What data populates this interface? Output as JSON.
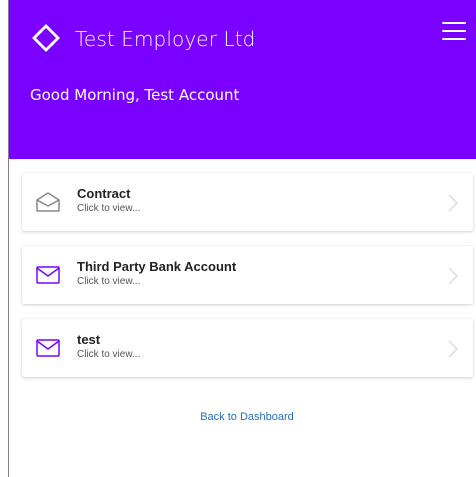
{
  "header": {
    "title": "Test Employer Ltd",
    "greeting": "Good Morning, Test Account",
    "background_color": "#7a00ff",
    "logo_icon": "logo-icon",
    "menu_icon": "hamburger-menu-icon"
  },
  "documents": [
    {
      "title": "Contract",
      "subtitle": "Click to view...",
      "icon": "envelope-open-icon",
      "icon_color": "#888888"
    },
    {
      "title": "Third Party Bank Account",
      "subtitle": "Click to view...",
      "icon": "envelope-icon",
      "icon_color": "#7a00ff"
    },
    {
      "title": "test",
      "subtitle": "Click to view...",
      "icon": "envelope-icon",
      "icon_color": "#7a00ff"
    }
  ],
  "footer": {
    "back_link": "Back to Dashboard",
    "link_color": "#1f6fbf"
  }
}
